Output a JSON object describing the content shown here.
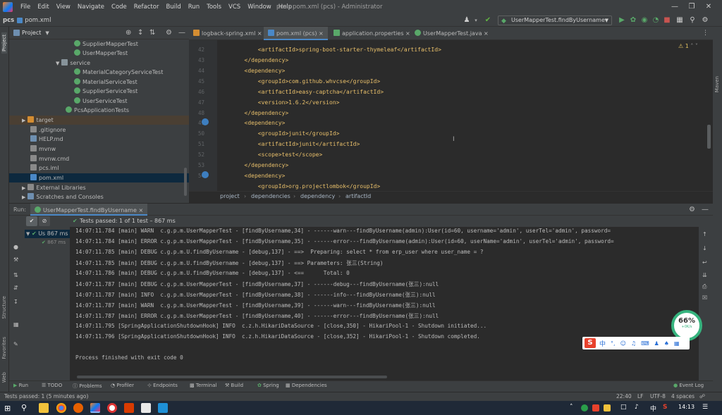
{
  "menubar": {
    "items": [
      "File",
      "Edit",
      "View",
      "Navigate",
      "Code",
      "Refactor",
      "Build",
      "Run",
      "Tools",
      "VCS",
      "Window",
      "Help"
    ],
    "window_title": "pcs - pom.xml (pcs) - Administrator"
  },
  "navbar": {
    "project": "pcs",
    "file": "pom.xml",
    "run_config": "UserMapperTest.findByUsername"
  },
  "project_panel": {
    "title": "Project",
    "tree": [
      {
        "label": "SupplierMapperTest",
        "type": "test"
      },
      {
        "label": "UserMapperTest",
        "type": "test"
      },
      {
        "label": "service",
        "type": "folder"
      },
      {
        "label": "MaterialCategoryServiceTest",
        "type": "test"
      },
      {
        "label": "MaterialServiceTest",
        "type": "test"
      },
      {
        "label": "SupplierServiceTest",
        "type": "test"
      },
      {
        "label": "UserServiceTest",
        "type": "test"
      },
      {
        "label": "PcsApplicationTests",
        "type": "test"
      },
      {
        "label": "target",
        "type": "folder-orange"
      },
      {
        "label": ".gitignore",
        "type": "file"
      },
      {
        "label": "HELP.md",
        "type": "file"
      },
      {
        "label": "mvnw",
        "type": "file"
      },
      {
        "label": "mvnw.cmd",
        "type": "file"
      },
      {
        "label": "pcs.iml",
        "type": "file"
      },
      {
        "label": "pom.xml",
        "type": "maven"
      },
      {
        "label": "External Libraries",
        "type": "lib"
      },
      {
        "label": "Scratches and Consoles",
        "type": "scratch"
      }
    ]
  },
  "editor_tabs": [
    "logback-spring.xml",
    "pom.xml (pcs)",
    "application.properties",
    "UserMapperTest.java"
  ],
  "editor": {
    "warning_count": "1",
    "lines": [
      {
        "n": "",
        "indent": "            ",
        "text": "<artifactId>spring-boot-starter-thymeleaf</artifactId>"
      },
      {
        "n": "42",
        "indent": "        ",
        "text": "</dependency>"
      },
      {
        "n": "43",
        "indent": "        ",
        "text": "<dependency>"
      },
      {
        "n": "44",
        "indent": "            ",
        "text": "<groupId>com.github.whvcse</groupId>"
      },
      {
        "n": "45",
        "indent": "            ",
        "text": "<artifactId>easy-captcha</artifactId>"
      },
      {
        "n": "46",
        "indent": "            ",
        "text": "<version>1.6.2</version>"
      },
      {
        "n": "47",
        "indent": "        ",
        "text": "</dependency>"
      },
      {
        "n": "48",
        "indent": "        ",
        "text": "<dependency>"
      },
      {
        "n": "49",
        "indent": "            ",
        "text": "<groupId>junit</groupId>"
      },
      {
        "n": "50",
        "indent": "            ",
        "text": "<artifactId>junit</artifactId>"
      },
      {
        "n": "51",
        "indent": "            ",
        "text": "<scope>test</scope>"
      },
      {
        "n": "52",
        "indent": "        ",
        "text": "</dependency>"
      },
      {
        "n": "53",
        "indent": "        ",
        "text": "<dependency>"
      },
      {
        "n": "54",
        "indent": "            ",
        "text": "<groupId>org.projectlombok</groupId>"
      }
    ],
    "breadcrumbs": [
      "project",
      "dependencies",
      "dependency",
      "artifactId"
    ]
  },
  "run_panel": {
    "label": "Run:",
    "tab": "UserMapperTest.findByUsername",
    "status": "Tests passed: 1 of 1 test – 867 ms",
    "tree_root": "Us 867 ms",
    "tree_child": "867 ms",
    "console": [
      "14:07:11.784 [main] WARN  c.g.p.m.UserMapperTest - [findByUsername,34] - ------warn---findByUsername(admin):User(id=60, username='admin', userTel='admin', password=",
      "14:07:11.784 [main] ERROR c.g.p.m.UserMapperTest - [findByUsername,35] - ------error---findByUsername(admin):User(id=60, userName='admin', userTel='admin', password=",
      "14:07:11.785 [main] DEBUG c.g.p.m.U.findByUsername - [debug,137] - ==>  Preparing: select * from erp_user where user_name = ?",
      "14:07:11.785 [main] DEBUG c.g.p.m.U.findByUsername - [debug,137] - ==> Parameters: 张三(String)",
      "14:07:11.786 [main] DEBUG c.g.p.m.U.findByUsername - [debug,137] - <==      Total: 0",
      "14:07:11.787 [main] DEBUG c.g.p.m.UserMapperTest - [findByUsername,37] - ------debug---findByUsername(张三):null",
      "14:07:11.787 [main] INFO  c.g.p.m.UserMapperTest - [findByUsername,38] - ------info---findByUsername(张三):null",
      "14:07:11.787 [main] WARN  c.g.p.m.UserMapperTest - [findByUsername,39] - ------warn---findByUsername(张三):null",
      "14:07:11.787 [main] ERROR c.g.p.m.UserMapperTest - [findByUsername,40] - ------error---findByUsername(张三):null",
      "14:07:11.795 [SpringApplicationShutdownHook] INFO  c.z.h.HikariDataSource - [close,350] - HikariPool-1 - Shutdown initiated...",
      "14:07:11.796 [SpringApplicationShutdownHook] INFO  c.z.h.HikariDataSource - [close,352] - HikariPool-1 - Shutdown completed.",
      "",
      "Process finished with exit code 0"
    ]
  },
  "bottom_tabs": [
    "Run",
    "TODO",
    "Problems",
    "Profiler",
    "Endpoints",
    "Terminal",
    "Build",
    "Spring",
    "Dependencies"
  ],
  "event_log": "Event Log",
  "statusbar": {
    "message": "Tests passed: 1 (5 minutes ago)",
    "position": "22:40",
    "line_sep": "LF",
    "encoding": "UTF-8",
    "indent": "4 spaces"
  },
  "overlay": {
    "gauge_value": "66%",
    "gauge_sub": "+0K/s",
    "ime_lang": "中"
  },
  "taskbar": {
    "lang": "中",
    "time": "14:13"
  },
  "side_labels": {
    "project": "Project",
    "structure": "Structure",
    "favorites": "Favorites",
    "web": "Web",
    "maven": "Maven"
  },
  "colors": {
    "accent": "#4a88c7",
    "pass": "#499c54",
    "bg": "#2b2b2b",
    "panel": "#3c3f41"
  }
}
